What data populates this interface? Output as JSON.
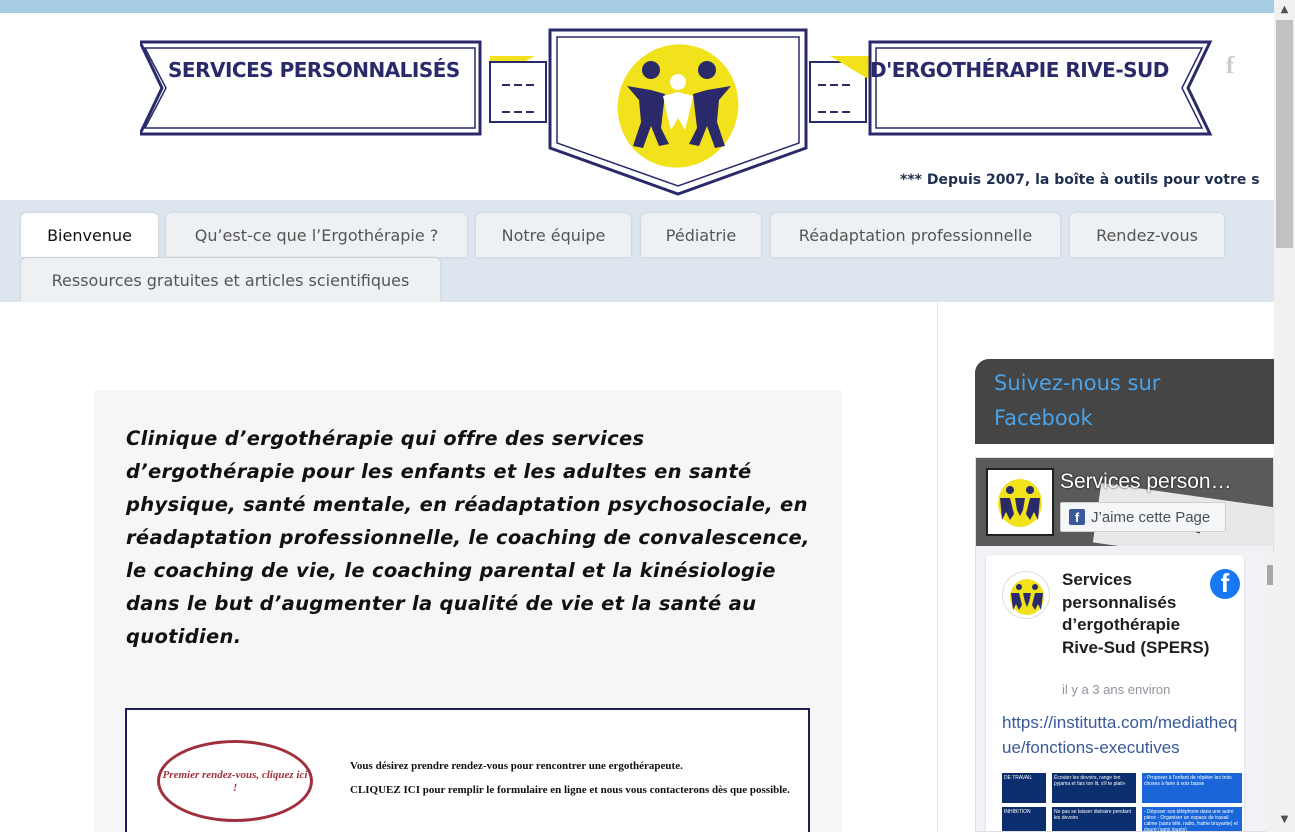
{
  "header": {
    "banner_left_text": "SERVICES PERSONNALISÉS",
    "banner_right_text": "D'ERGOTHÉRAPIE RIVE-SUD",
    "tagline": "*** Depuis 2007, la boîte à outils pour votre s",
    "facebook_icon": "facebook-icon",
    "colors": {
      "navy": "#2a2a6a",
      "yellow": "#f2e21b",
      "topbar": "#a7cce6"
    }
  },
  "nav": {
    "tabs": [
      {
        "label": "Bienvenue",
        "active": true
      },
      {
        "label": "Qu’est-ce que l’Ergothérapie ?"
      },
      {
        "label": "Notre équipe"
      },
      {
        "label": "Pédiatrie"
      },
      {
        "label": "Réadaptation professionnelle"
      },
      {
        "label": "Rendez-vous"
      },
      {
        "label": "Ressources gratuites et articles scientifiques"
      }
    ]
  },
  "main": {
    "intro": "Clinique d’ergothérapie qui offre des services d’ergothérapie pour les enfants et les adultes en santé physique, santé mentale, en réadaptation psychosociale, en réadaptation professionnelle, le coaching de convalescence, le coaching de vie, le coaching parental et la kinésiologie dans le but d’augmenter la qualité de vie et la santé au quotidien.",
    "appointment": {
      "oval_text": "Premier rendez-vous, cliquez ici !",
      "line1": "Vous désirez prendre rendez-vous pour rencontrer une ergothérapeute.",
      "line2": "CLIQUEZ ICI pour remplir le formulaire en ligne et nous vous contacterons dès que possible."
    }
  },
  "sidebar": {
    "title": "Suivez-nous sur Facebook",
    "fb": {
      "page_name": "Services person…",
      "like_label": "J’aime cette Page",
      "cover_text": "ational T",
      "post": {
        "author": "Services personnalisés d’ergothérapie Rive-Sud (SPERS)",
        "time": "il y a 3 ans environ",
        "link": "https://institutta.com/mediatheque/fonctions-executives",
        "img_cells": {
          "c1": "DE TRAVAIL",
          "c2": "Écouter les devoirs, range ton pyjama et fais ton lit, s'il te plait»",
          "c3": "- Proposer à l'enfant de répéter les trois choses à faire à voix basse",
          "c4": "INHIBITION",
          "c5": "Ne pas se laisser distraire pendant les devoirs",
          "c6": "- Déposer son téléphone dans une autre pièce - Organiser un espace de travail calme (sans télé, radio, fratrie bruyante) et épuré (sans jouets)"
        }
      }
    }
  }
}
